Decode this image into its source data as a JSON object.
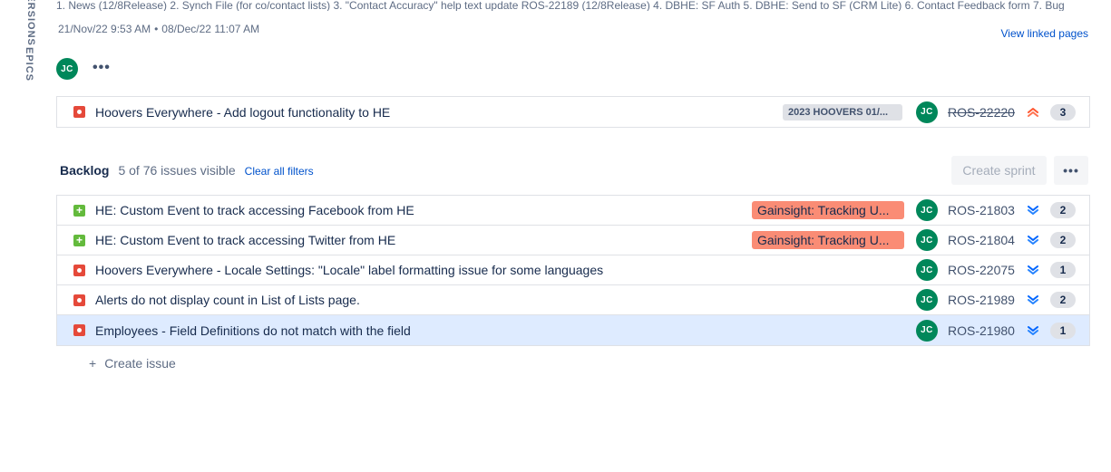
{
  "side_tabs": {
    "versions_label": "VERSIONS",
    "epics_label": "EPICS"
  },
  "sprint": {
    "description": "1. News (12/8Release) 2. Synch File (for co/contact lists) 3. \"Contact Accuracy\" help text update ROS-22189 (12/8Release) 4. DBHE: SF Auth 5. DBHE: Send to SF (CRM Lite) 6. Contact Feedback form 7. Bug",
    "start_date": "21/Nov/22 9:53 AM",
    "separator": "•",
    "end_date": "08/Dec/22 11:07 AM",
    "view_linked_label": "View linked pages",
    "assignee_initials": "JC",
    "more_label": "•••",
    "issues": [
      {
        "type": "bug",
        "summary": "Hoovers Everywhere - Add logout functionality to HE",
        "epic": "2023 HOOVERS 01/...",
        "assignee_initials": "JC",
        "key": "ROS-22220",
        "done": true,
        "priority": "highest",
        "count": "3"
      }
    ]
  },
  "backlog": {
    "title": "Backlog",
    "visible_count": "5 of 76 issues visible",
    "clear_filters_label": "Clear all filters",
    "create_sprint_label": "Create sprint",
    "more_label": "•••",
    "issues": [
      {
        "type": "story",
        "summary": "HE: Custom Event to track accessing Facebook from HE",
        "epic": "Gainsight: Tracking U...",
        "assignee_initials": "JC",
        "key": "ROS-21803",
        "priority": "lowest",
        "count": "2"
      },
      {
        "type": "story",
        "summary": "HE: Custom Event to track accessing Twitter from HE",
        "epic": "Gainsight: Tracking U...",
        "assignee_initials": "JC",
        "key": "ROS-21804",
        "priority": "lowest",
        "count": "2"
      },
      {
        "type": "bug",
        "summary": "Hoovers Everywhere - Locale Settings: \"Locale\" label formatting issue for some languages",
        "epic": "",
        "assignee_initials": "JC",
        "key": "ROS-22075",
        "priority": "lowest",
        "count": "1"
      },
      {
        "type": "bug",
        "summary": "Alerts do not display count in List of Lists page.",
        "epic": "",
        "assignee_initials": "JC",
        "key": "ROS-21989",
        "priority": "lowest",
        "count": "2"
      },
      {
        "type": "bug",
        "summary": "Employees - Field Definitions do not match with the field",
        "epic": "",
        "assignee_initials": "JC",
        "key": "ROS-21980",
        "priority": "lowest",
        "count": "1",
        "selected": true
      }
    ],
    "create_issue_icon": "+",
    "create_issue_label": "Create issue"
  },
  "colors": {
    "bug": "#e5493a",
    "story": "#63ba3c",
    "avatar": "#00875a",
    "epic_salmon": "#fa8c75",
    "priority_highest": "#ff5630",
    "priority_lowest": "#0065ff",
    "link": "#0052cc",
    "selected_row": "#deebff"
  }
}
